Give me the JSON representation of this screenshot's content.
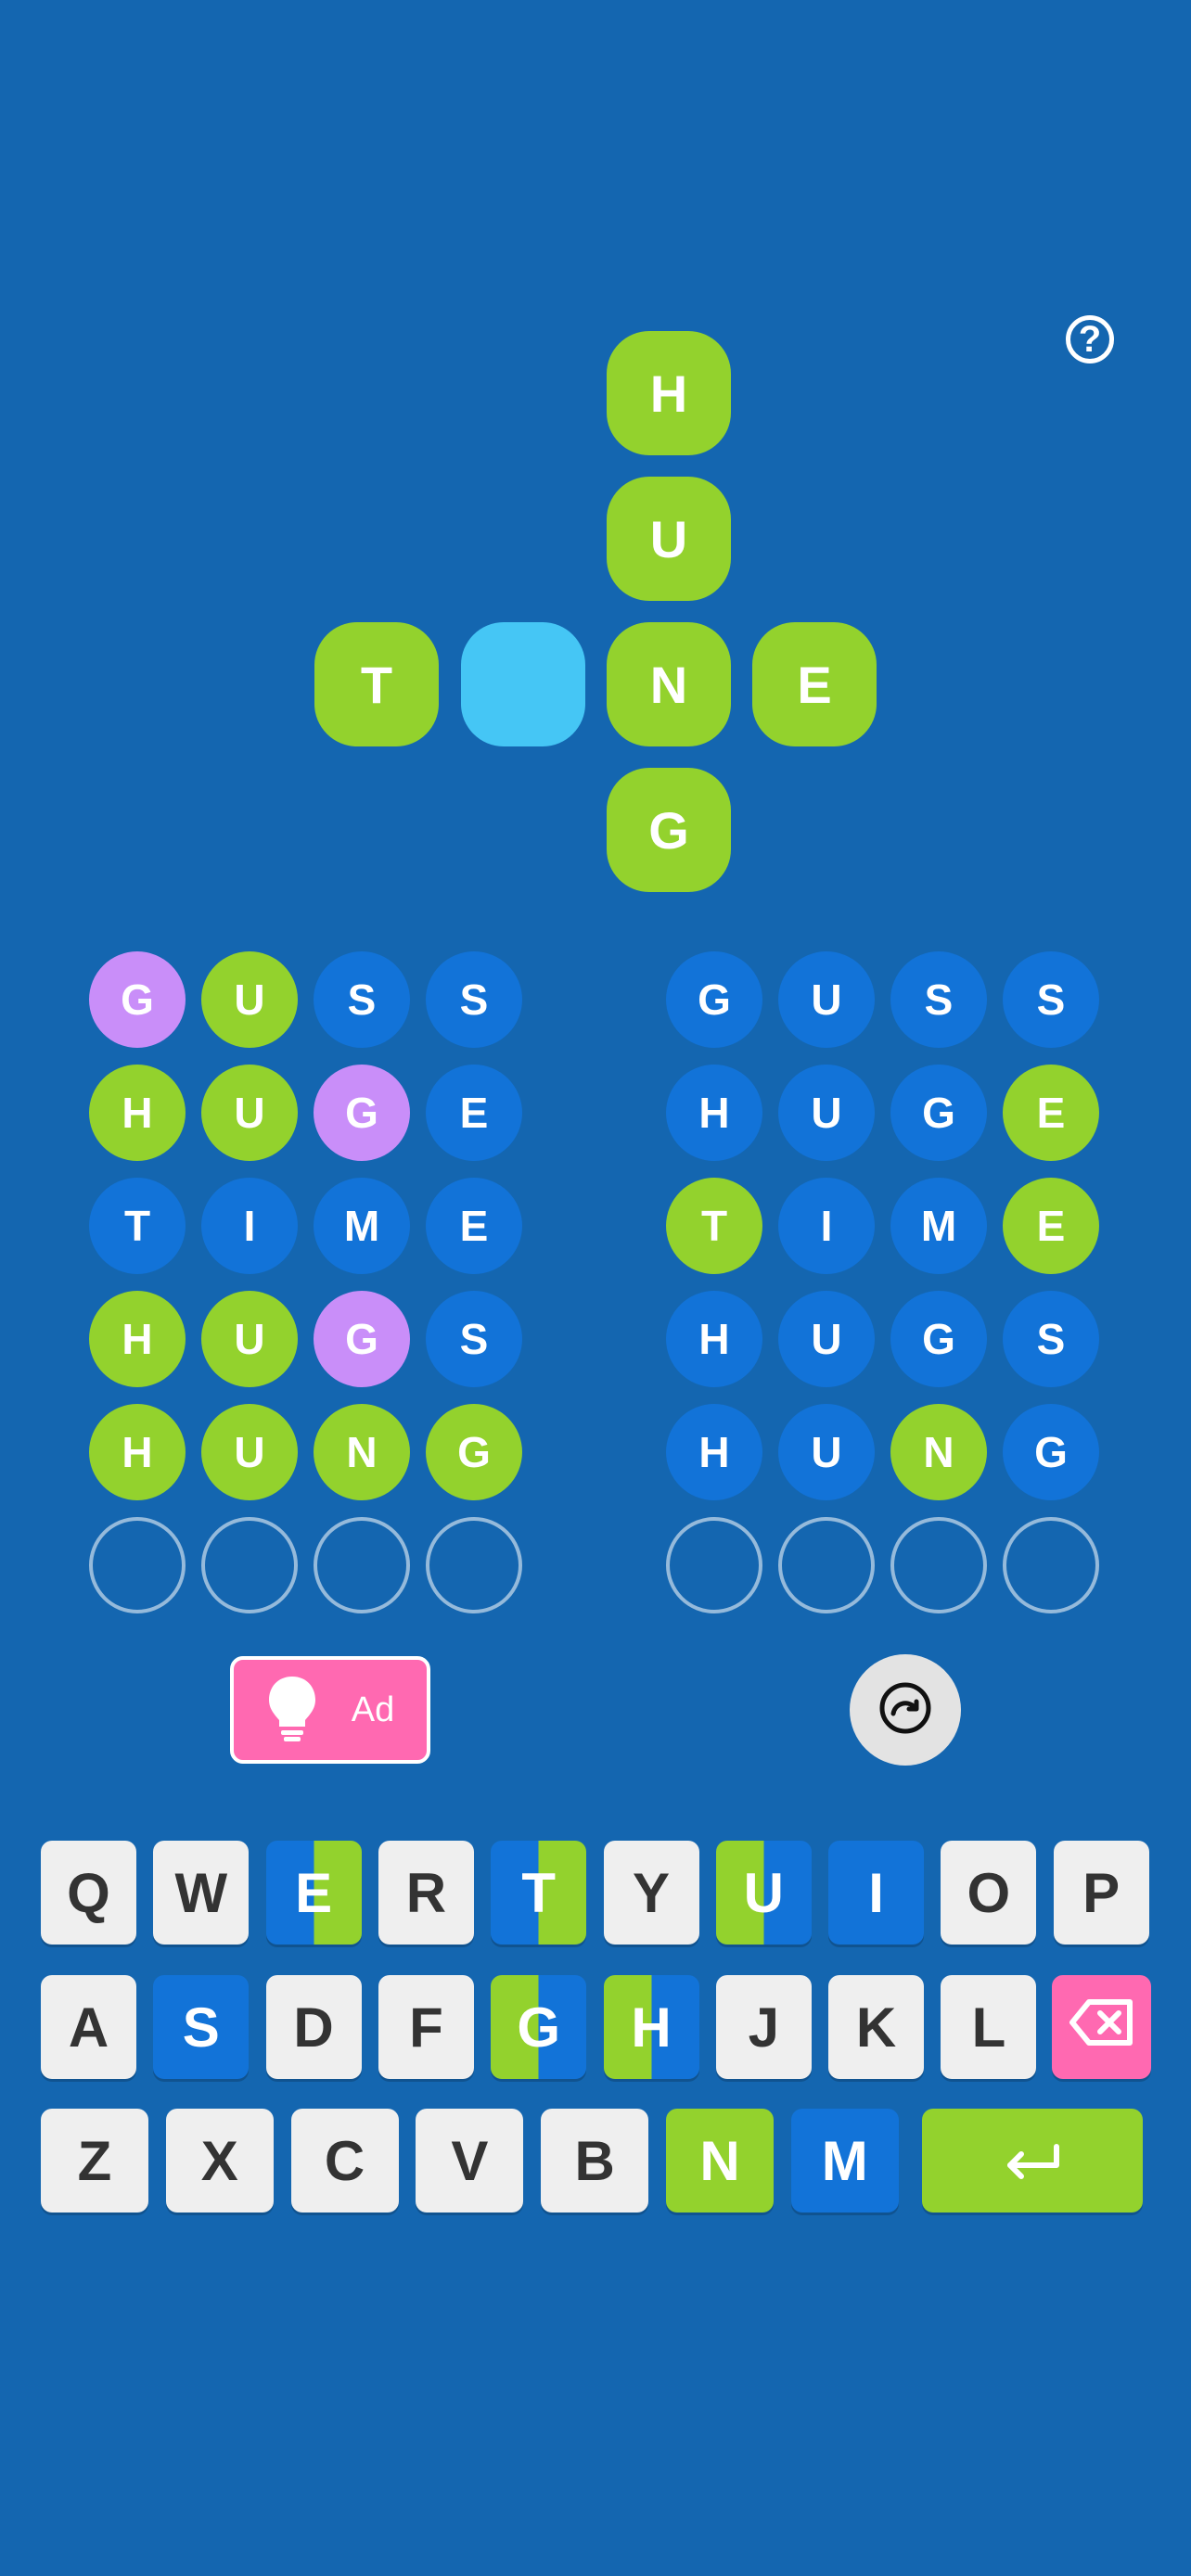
{
  "crossword": {
    "top": [
      "H",
      "U"
    ],
    "left": [
      "T",
      ""
    ],
    "center": "N",
    "right": [
      "E"
    ],
    "bottom": [
      "G"
    ]
  },
  "boards": {
    "left": [
      [
        {
          "l": "G",
          "s": "purple"
        },
        {
          "l": "U",
          "s": "green"
        },
        {
          "l": "S",
          "s": "blue"
        },
        {
          "l": "S",
          "s": "blue"
        }
      ],
      [
        {
          "l": "H",
          "s": "green"
        },
        {
          "l": "U",
          "s": "green"
        },
        {
          "l": "G",
          "s": "purple"
        },
        {
          "l": "E",
          "s": "blue"
        }
      ],
      [
        {
          "l": "T",
          "s": "blue"
        },
        {
          "l": "I",
          "s": "blue"
        },
        {
          "l": "M",
          "s": "blue"
        },
        {
          "l": "E",
          "s": "blue"
        }
      ],
      [
        {
          "l": "H",
          "s": "green"
        },
        {
          "l": "U",
          "s": "green"
        },
        {
          "l": "G",
          "s": "purple"
        },
        {
          "l": "S",
          "s": "blue"
        }
      ],
      [
        {
          "l": "H",
          "s": "green"
        },
        {
          "l": "U",
          "s": "green"
        },
        {
          "l": "N",
          "s": "green"
        },
        {
          "l": "G",
          "s": "green"
        }
      ],
      [
        {
          "l": "",
          "s": "empty"
        },
        {
          "l": "",
          "s": "empty"
        },
        {
          "l": "",
          "s": "empty"
        },
        {
          "l": "",
          "s": "empty"
        }
      ]
    ],
    "right": [
      [
        {
          "l": "G",
          "s": "blue"
        },
        {
          "l": "U",
          "s": "blue"
        },
        {
          "l": "S",
          "s": "blue"
        },
        {
          "l": "S",
          "s": "blue"
        }
      ],
      [
        {
          "l": "H",
          "s": "blue"
        },
        {
          "l": "U",
          "s": "blue"
        },
        {
          "l": "G",
          "s": "blue"
        },
        {
          "l": "E",
          "s": "green"
        }
      ],
      [
        {
          "l": "T",
          "s": "green"
        },
        {
          "l": "I",
          "s": "blue"
        },
        {
          "l": "M",
          "s": "blue"
        },
        {
          "l": "E",
          "s": "green"
        }
      ],
      [
        {
          "l": "H",
          "s": "blue"
        },
        {
          "l": "U",
          "s": "blue"
        },
        {
          "l": "G",
          "s": "blue"
        },
        {
          "l": "S",
          "s": "blue"
        }
      ],
      [
        {
          "l": "H",
          "s": "blue"
        },
        {
          "l": "U",
          "s": "blue"
        },
        {
          "l": "N",
          "s": "green"
        },
        {
          "l": "G",
          "s": "blue"
        }
      ],
      [
        {
          "l": "",
          "s": "empty"
        },
        {
          "l": "",
          "s": "empty"
        },
        {
          "l": "",
          "s": "empty"
        },
        {
          "l": "",
          "s": "empty"
        }
      ]
    ]
  },
  "hint": {
    "label": "Ad",
    "icon": "lightbulb-icon"
  },
  "reset": {
    "icon": "redo-icon"
  },
  "help": {
    "icon": "question-icon",
    "label": "?"
  },
  "keyboard": {
    "row1": [
      {
        "k": "Q",
        "s": "gray"
      },
      {
        "k": "W",
        "s": "gray"
      },
      {
        "k": "E",
        "s": "split-bg"
      },
      {
        "k": "R",
        "s": "gray"
      },
      {
        "k": "T",
        "s": "split-bg"
      },
      {
        "k": "Y",
        "s": "gray"
      },
      {
        "k": "U",
        "s": "split-gb"
      },
      {
        "k": "I",
        "s": "blue"
      },
      {
        "k": "O",
        "s": "gray"
      },
      {
        "k": "P",
        "s": "gray"
      }
    ],
    "row2": [
      {
        "k": "A",
        "s": "gray"
      },
      {
        "k": "S",
        "s": "blue"
      },
      {
        "k": "D",
        "s": "gray"
      },
      {
        "k": "F",
        "s": "gray"
      },
      {
        "k": "G",
        "s": "split-gb"
      },
      {
        "k": "H",
        "s": "split-gb"
      },
      {
        "k": "J",
        "s": "gray"
      },
      {
        "k": "K",
        "s": "gray"
      },
      {
        "k": "L",
        "s": "gray"
      }
    ],
    "row3": [
      {
        "k": "Z",
        "s": "gray"
      },
      {
        "k": "X",
        "s": "gray"
      },
      {
        "k": "C",
        "s": "gray"
      },
      {
        "k": "V",
        "s": "gray"
      },
      {
        "k": "B",
        "s": "gray"
      },
      {
        "k": "N",
        "s": "green"
      },
      {
        "k": "M",
        "s": "blue"
      }
    ],
    "backspace_icon": "backspace-icon",
    "enter_icon": "enter-icon",
    "colors": {
      "green": "#93d22d",
      "blue": "#1273d8",
      "purple": "#c98ef9",
      "pink": "#ff69b1",
      "gray": "#efefef"
    }
  }
}
